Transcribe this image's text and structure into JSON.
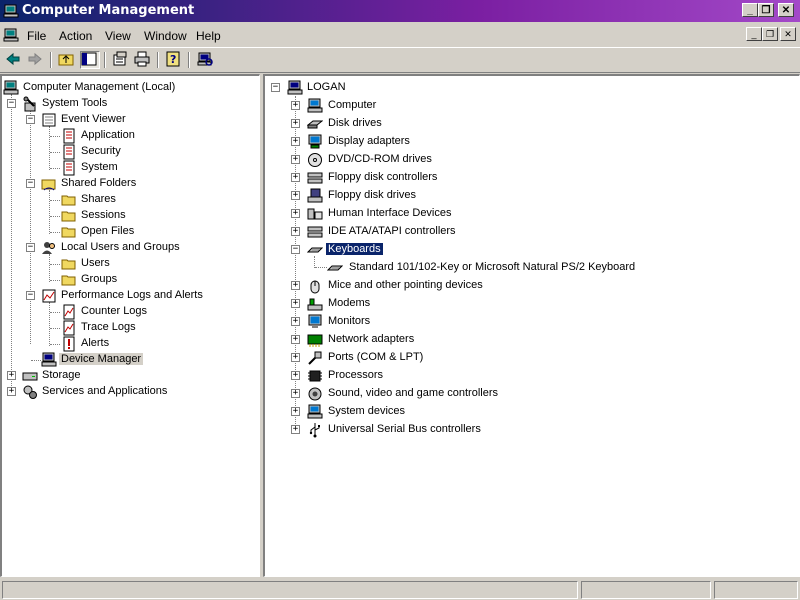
{
  "window": {
    "title": "Computer Management"
  },
  "menu": {
    "items": [
      "File",
      "Action",
      "View",
      "Window",
      "Help"
    ]
  },
  "left_tree": {
    "root": "Computer Management (Local)",
    "system_tools": "System Tools",
    "event_viewer": "Event Viewer",
    "application": "Application",
    "security": "Security",
    "system": "System",
    "shared_folders": "Shared Folders",
    "shares": "Shares",
    "sessions": "Sessions",
    "open_files": "Open Files",
    "local_users": "Local Users and Groups",
    "users": "Users",
    "groups": "Groups",
    "perf_logs": "Performance Logs and Alerts",
    "counter_logs": "Counter Logs",
    "trace_logs": "Trace Logs",
    "alerts": "Alerts",
    "device_manager": "Device Manager",
    "storage": "Storage",
    "services": "Services and Applications"
  },
  "right_tree": {
    "root": "LOGAN",
    "devices": [
      "Computer",
      "Disk drives",
      "Display adapters",
      "DVD/CD-ROM drives",
      "Floppy disk controllers",
      "Floppy disk drives",
      "Human Interface Devices",
      "IDE ATA/ATAPI controllers",
      "Keyboards",
      "Mice and other pointing devices",
      "Modems",
      "Monitors",
      "Network adapters",
      "Ports (COM & LPT)",
      "Processors",
      "Sound, video and game controllers",
      "System devices",
      "Universal Serial Bus controllers"
    ],
    "keyboard_child": "Standard 101/102-Key or Microsoft Natural PS/2 Keyboard"
  },
  "colors": {
    "title_start": "#0a246a",
    "title_end": "#a349c8",
    "selection": "#0a246a",
    "face": "#d4d0c8"
  }
}
